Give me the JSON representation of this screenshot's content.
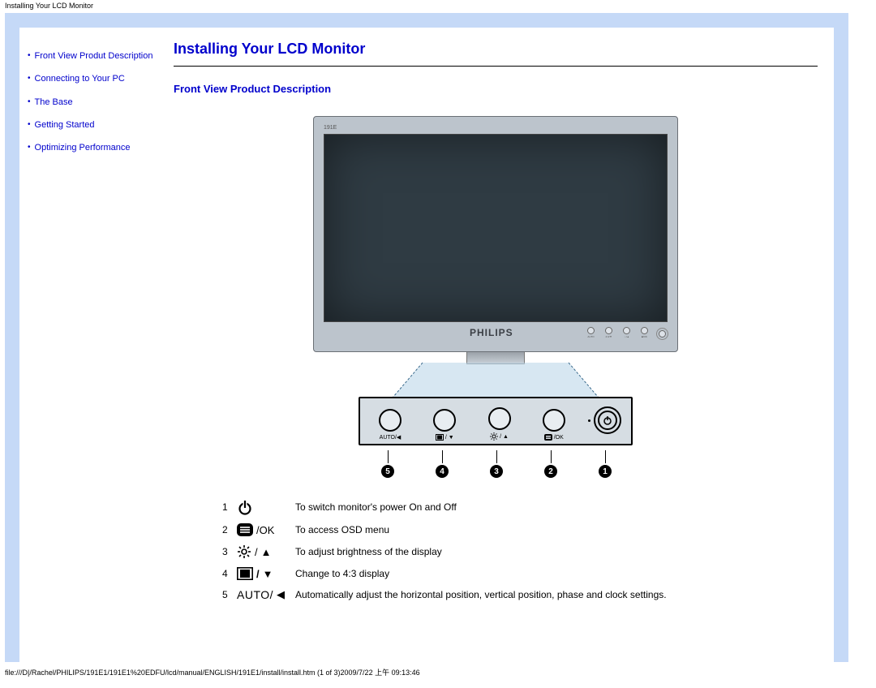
{
  "window_title": "Installing Your LCD Monitor",
  "page": {
    "main_title": "Installing Your LCD Monitor",
    "section_title": "Front View Product Description"
  },
  "sidebar": {
    "items": [
      {
        "label": "Front View Produt Description"
      },
      {
        "label": "Connecting to Your PC"
      },
      {
        "label": "The Base"
      },
      {
        "label": "Getting Started"
      },
      {
        "label": "Optimizing Performance"
      }
    ]
  },
  "monitor": {
    "model": "191E",
    "brand": "PHILIPS",
    "bezel_buttons": [
      {
        "label": "AUTO"
      },
      {
        "label": "4:3/▼"
      },
      {
        "label": "☼/▲"
      },
      {
        "label": "■/OK"
      },
      {
        "label": "⏻"
      }
    ]
  },
  "panel": {
    "buttons": [
      {
        "label": "AUTO/◀"
      },
      {
        "label": "4:3 / ▼"
      },
      {
        "label": "☼ / ▲"
      },
      {
        "label": "■/OK"
      }
    ]
  },
  "callouts": [
    "5",
    "4",
    "3",
    "2",
    "1"
  ],
  "legend": [
    {
      "num": "1",
      "icon": "power-icon",
      "text": "To switch monitor's power On and Off"
    },
    {
      "num": "2",
      "icon": "menu-ok-icon",
      "icon_text": "/OK",
      "text": "To access OSD menu"
    },
    {
      "num": "3",
      "icon": "brightness-up-icon",
      "text": "To adjust brightness of the display"
    },
    {
      "num": "4",
      "icon": "aspect-down-icon",
      "text": "Change to 4:3 display"
    },
    {
      "num": "5",
      "icon": "auto-left-icon",
      "icon_text": "AUTO/",
      "text": "Automatically adjust the horizontal position, vertical position, phase and clock settings."
    }
  ],
  "footer_path": "file:///D|/Rachel/PHILIPS/191E1/191E1%20EDFU/lcd/manual/ENGLISH/191E1/install/install.htm (1 of 3)2009/7/22 上午 09:13:46"
}
